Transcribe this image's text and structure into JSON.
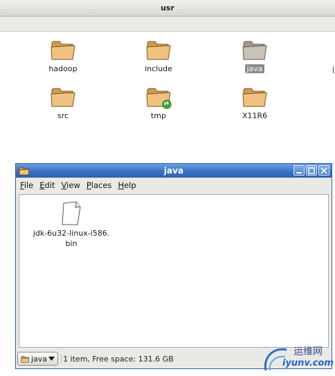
{
  "background_window": {
    "title": "usr",
    "items": [
      {
        "label": "hadoop",
        "icon": "folder-icon",
        "selected": false
      },
      {
        "label": "include",
        "icon": "folder-icon",
        "selected": false
      },
      {
        "label": "java",
        "icon": "folder-icon",
        "selected": true
      },
      {
        "label": "src",
        "icon": "folder-icon",
        "selected": false
      },
      {
        "label": "tmp",
        "icon": "folder-symlink-icon",
        "selected": false
      },
      {
        "label": "X11R6",
        "icon": "folder-icon",
        "selected": false
      }
    ]
  },
  "java_window": {
    "title": "java",
    "menu": [
      {
        "label": "File",
        "mnemonic": "F",
        "rest": "ile"
      },
      {
        "label": "Edit",
        "mnemonic": "E",
        "rest": "dit"
      },
      {
        "label": "View",
        "mnemonic": "V",
        "rest": "iew"
      },
      {
        "label": "Places",
        "mnemonic": "P",
        "rest": "laces"
      },
      {
        "label": "Help",
        "mnemonic": "H",
        "rest": "elp"
      }
    ],
    "files": [
      {
        "label_line1": "jdk-6u32-linux-i586.",
        "label_line2": "bin",
        "icon": "document-icon"
      }
    ],
    "location_button": "java",
    "status": "1 item, Free space: 131.6 GB"
  },
  "watermark": {
    "cn": "运维网",
    "en": "iyunv.com"
  },
  "colors": {
    "titlebar": "#3a72c4",
    "folder": "#e9b56f",
    "selected_label": "#8a8a8a"
  }
}
